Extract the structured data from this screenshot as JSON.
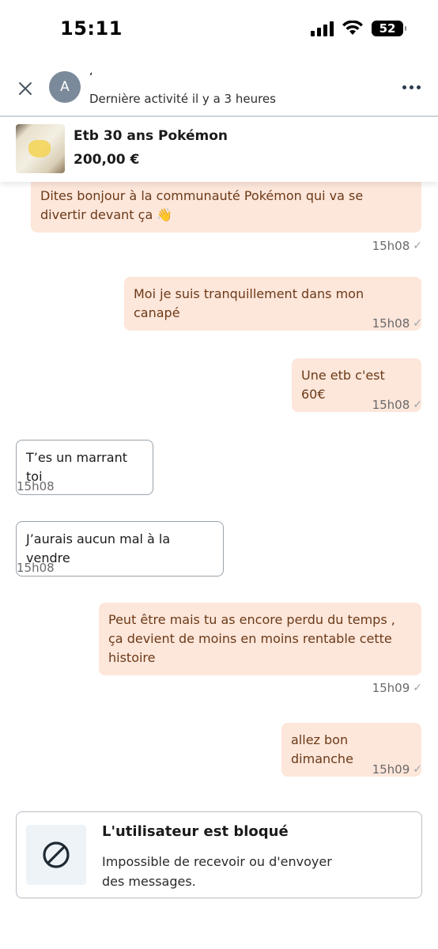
{
  "status_bar": {
    "time": "15:11",
    "battery": "52"
  },
  "header": {
    "avatar_initial": "A",
    "user_name": "ʻ",
    "activity": "Dernière activité il y a 3 heures"
  },
  "item": {
    "title": "Etb 30 ans Pokémon",
    "price": "200,00 €"
  },
  "messages": [
    {
      "dir": "out",
      "text": "Dites bonjour à la communauté Pokémon qui va se divertir devant ça 👋",
      "time": "15h08"
    },
    {
      "dir": "out",
      "text": "Moi je suis tranquillement dans mon canapé",
      "time": "15h08"
    },
    {
      "dir": "out",
      "text": "Une etb c'est 60€",
      "time": "15h08"
    },
    {
      "dir": "in",
      "text": "T’es un marrant toi",
      "time": "15h08"
    },
    {
      "dir": "in",
      "text": "J’aurais aucun mal à la vendre",
      "time": "15h08"
    },
    {
      "dir": "out",
      "text": "Peut être mais tu as encore perdu du temps , ça devient de moins en moins rentable cette histoire",
      "time": "15h09"
    },
    {
      "dir": "out",
      "text": "allez bon dimanche",
      "time": "15h09"
    }
  ],
  "blocked": {
    "title": "L'utilisateur est bloqué",
    "description": "Impossible de recevoir ou d'envoyer des messages."
  },
  "colors": {
    "outgoing_bubble": "#fde6da",
    "outgoing_text": "#6b3a18",
    "incoming_border": "#9aa3ab",
    "avatar": "#7a8a9a"
  },
  "icons": {
    "close": "close-icon",
    "more": "more-options-icon",
    "read_check": "check-icon",
    "blocked": "blocked-icon"
  }
}
